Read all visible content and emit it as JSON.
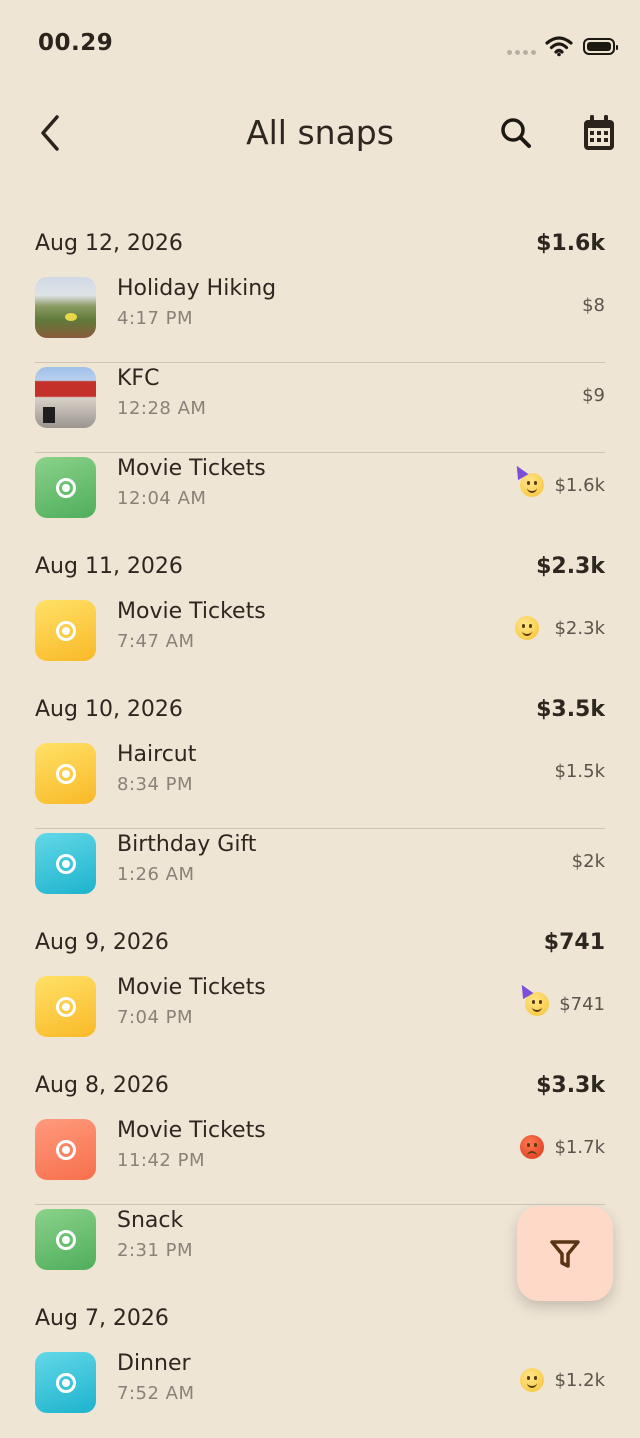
{
  "status_bar": {
    "time": "00.29"
  },
  "header": {
    "title": "All snaps"
  },
  "icons": {
    "back": "chevron-left-icon",
    "search": "search-icon",
    "calendar": "calendar-icon",
    "filter": "filter-icon"
  },
  "colors": {
    "background": "#efe5d5",
    "fab": "#ffd9c7",
    "green": "#5ab766",
    "yellow": "#fbc531",
    "cyan": "#27b8d0",
    "orange": "#f77c58"
  },
  "groups": [
    {
      "date": "Aug 12, 2026",
      "total": "$1.6k",
      "items": [
        {
          "title": "Holiday Hiking",
          "time": "4:17 PM",
          "amount": "$8",
          "thumb": "photo-hiking"
        },
        {
          "title": "KFC",
          "time": "12:28 AM",
          "amount": "$9",
          "thumb": "photo-kfc"
        },
        {
          "title": "Movie Tickets",
          "time": "12:04 AM",
          "amount": "$1.6k",
          "thumb": "green",
          "emoji": "party"
        }
      ]
    },
    {
      "date": "Aug 11, 2026",
      "total": "$2.3k",
      "items": [
        {
          "title": "Movie Tickets",
          "time": "7:47 AM",
          "amount": "$2.3k",
          "thumb": "yellow",
          "emoji": "smile"
        }
      ]
    },
    {
      "date": "Aug 10, 2026",
      "total": "$3.5k",
      "items": [
        {
          "title": "Haircut",
          "time": "8:34 PM",
          "amount": "$1.5k",
          "thumb": "yellow"
        },
        {
          "title": "Birthday Gift",
          "time": "1:26 AM",
          "amount": "$2k",
          "thumb": "cyan"
        }
      ]
    },
    {
      "date": "Aug 9, 2026",
      "total": "$741",
      "items": [
        {
          "title": "Movie Tickets",
          "time": "7:04 PM",
          "amount": "$741",
          "thumb": "yellow",
          "emoji": "party"
        }
      ]
    },
    {
      "date": "Aug 8, 2026",
      "total": "$3.3k",
      "items": [
        {
          "title": "Movie Tickets",
          "time": "11:42 PM",
          "amount": "$1.7k",
          "thumb": "orange",
          "emoji": "angry"
        },
        {
          "title": "Snack",
          "time": "2:31 PM",
          "amount": "",
          "thumb": "green"
        }
      ]
    },
    {
      "date": "Aug 7, 2026",
      "total": "",
      "items": [
        {
          "title": "Dinner",
          "time": "7:52 AM",
          "amount": "$1.2k",
          "thumb": "cyan",
          "emoji": "smile"
        }
      ]
    }
  ]
}
